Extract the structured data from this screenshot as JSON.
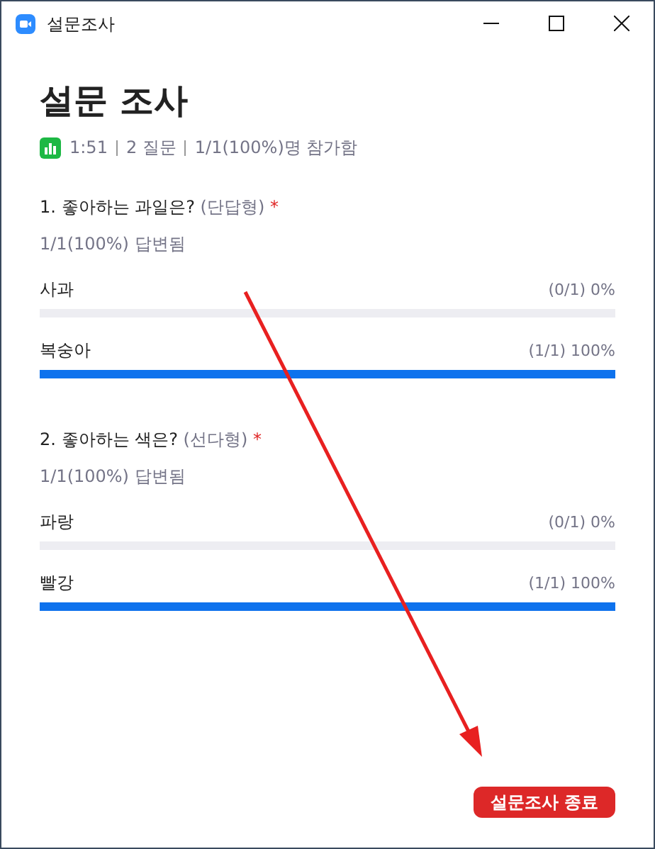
{
  "window": {
    "title": "설문조사"
  },
  "heading": "설문 조사",
  "meta": {
    "duration": "1:51",
    "questions": "2 질문",
    "participants": "1/1(100%)명 참가함"
  },
  "questions": [
    {
      "number": "1.",
      "text": "좋아하는 과일은?",
      "type": "(단답형)",
      "required_mark": "*",
      "answered": "1/1(100%) 답변됨",
      "options": [
        {
          "label": "사과",
          "result": "(0/1) 0%",
          "level": 0
        },
        {
          "label": "복숭아",
          "result": "(1/1) 100%",
          "level": 1
        }
      ]
    },
    {
      "number": "2.",
      "text": "좋아하는 색은?",
      "type": "(선다형)",
      "required_mark": "*",
      "answered": "1/1(100%) 답변됨",
      "options": [
        {
          "label": "파랑",
          "result": "(0/1) 0%",
          "level": 0
        },
        {
          "label": "빨강",
          "result": "(1/1) 100%",
          "level": 1
        }
      ]
    }
  ],
  "end_button": "설문조사 종료"
}
